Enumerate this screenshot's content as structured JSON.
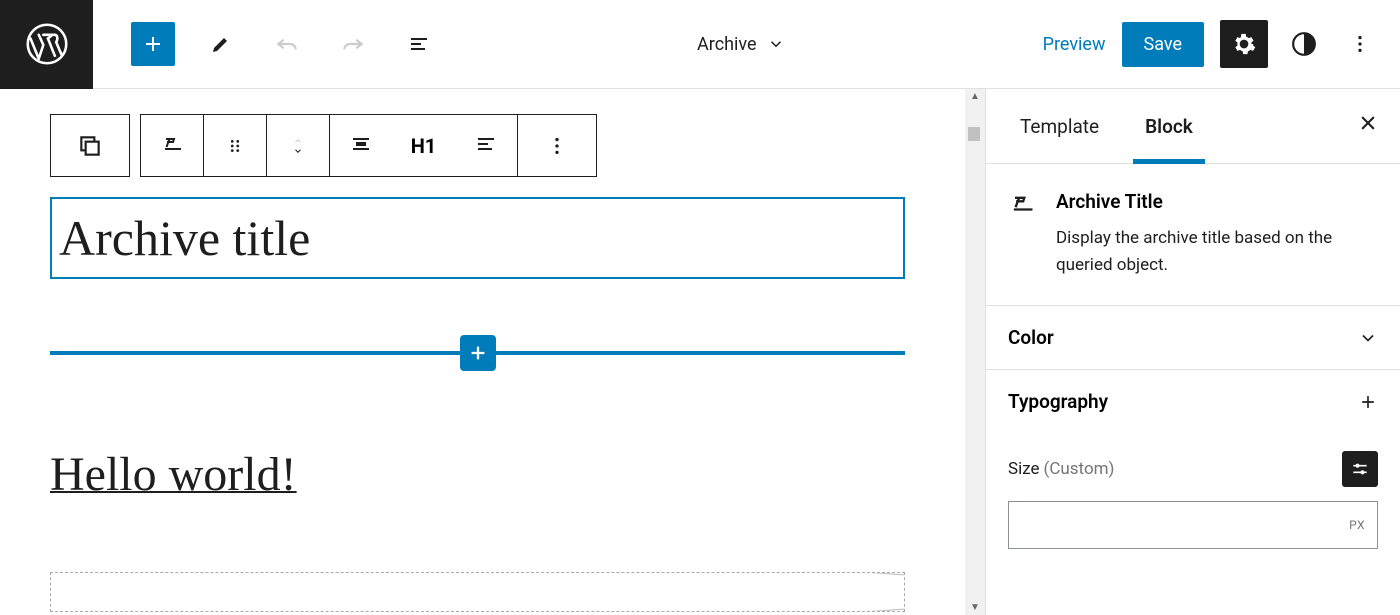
{
  "topbar": {
    "template_name": "Archive",
    "preview_label": "Preview",
    "save_label": "Save"
  },
  "block_toolbar": {
    "heading_level": "H1"
  },
  "canvas": {
    "archive_title": "Archive title",
    "post_title": "Hello world!"
  },
  "sidebar": {
    "tabs": {
      "template": "Template",
      "block": "Block"
    },
    "block_info": {
      "name": "Archive Title",
      "description": "Display the archive title based on the queried object."
    },
    "panels": {
      "color": "Color",
      "typography": "Typography"
    },
    "typography": {
      "size_label": "Size",
      "size_custom_label": "(Custom)",
      "size_unit": "PX"
    }
  }
}
